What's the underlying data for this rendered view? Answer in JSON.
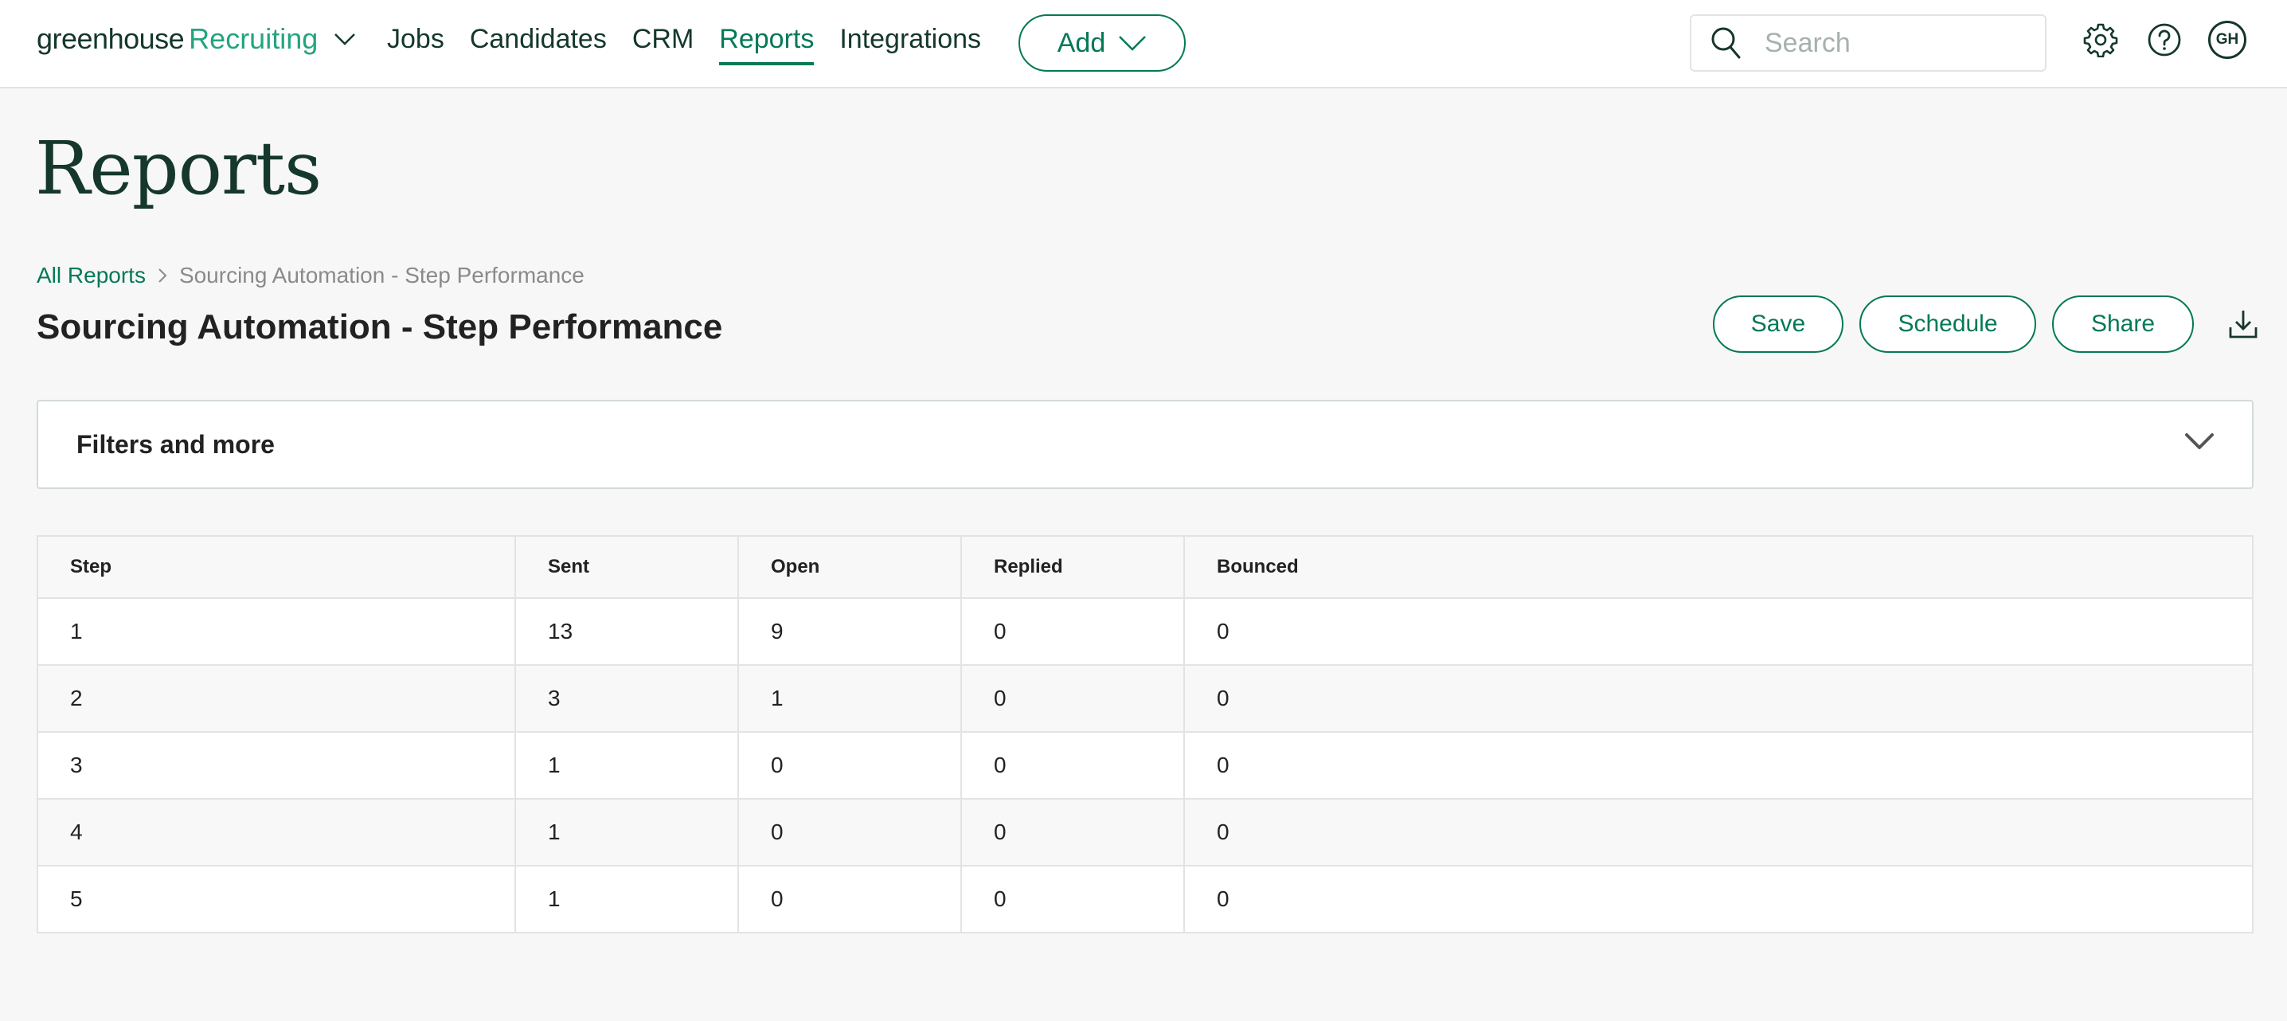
{
  "nav": {
    "brand_primary": "greenhouse",
    "brand_secondary": "Recruiting",
    "links": [
      {
        "label": "Jobs",
        "active": false
      },
      {
        "label": "Candidates",
        "active": false
      },
      {
        "label": "CRM",
        "active": false
      },
      {
        "label": "Reports",
        "active": true
      },
      {
        "label": "Integrations",
        "active": false
      }
    ],
    "add_label": "Add",
    "search_placeholder": "Search",
    "search_value": "",
    "avatar_initials": "GH",
    "icons": [
      "search-icon",
      "gear-icon",
      "help-icon",
      "avatar"
    ]
  },
  "page": {
    "title": "Reports",
    "breadcrumb": {
      "parent": "All Reports",
      "current": "Sourcing Automation - Step Performance"
    },
    "report_title": "Sourcing Automation - Step Performance"
  },
  "actions": {
    "save": "Save",
    "schedule": "Schedule",
    "share": "Share",
    "download_icon": "download-icon"
  },
  "filters": {
    "label": "Filters and more",
    "expanded": false
  },
  "table": {
    "columns": [
      "Step",
      "Sent",
      "Open",
      "Replied",
      "Bounced"
    ],
    "rows": [
      [
        "1",
        "13",
        "9",
        "0",
        "0"
      ],
      [
        "2",
        "3",
        "1",
        "0",
        "0"
      ],
      [
        "3",
        "1",
        "0",
        "0",
        "0"
      ],
      [
        "4",
        "1",
        "0",
        "0",
        "0"
      ],
      [
        "5",
        "1",
        "0",
        "0",
        "0"
      ]
    ]
  },
  "colors": {
    "brand_green": "#047957",
    "brand_light_green": "#24a47f",
    "dark_green": "#15372c",
    "page_bg": "#f7f7f7"
  }
}
